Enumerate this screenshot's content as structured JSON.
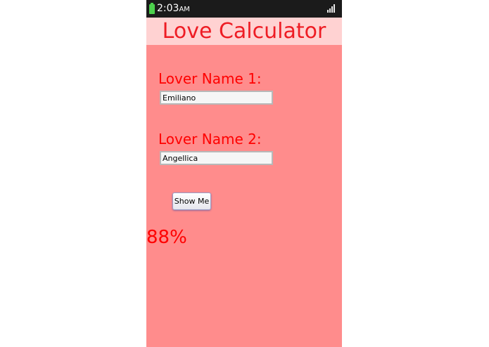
{
  "status_bar": {
    "time": "2:03",
    "ampm": "AM",
    "battery_icon": "battery-icon",
    "signal_icon": "signal-bars-icon"
  },
  "app": {
    "title": "Love Calculator"
  },
  "form": {
    "lover1_label": "Lover Name 1:",
    "lover1_value": "Emiliano",
    "lover2_label": "Lover Name 2:",
    "lover2_value": "Angellica",
    "button_label": "Show Me"
  },
  "result": {
    "percentage_text": "88%"
  },
  "colors": {
    "background": "#ff8c8c",
    "title_bar": "#ffd2d2",
    "text_red": "#ff0000",
    "status_bar": "#1b1b1b"
  }
}
